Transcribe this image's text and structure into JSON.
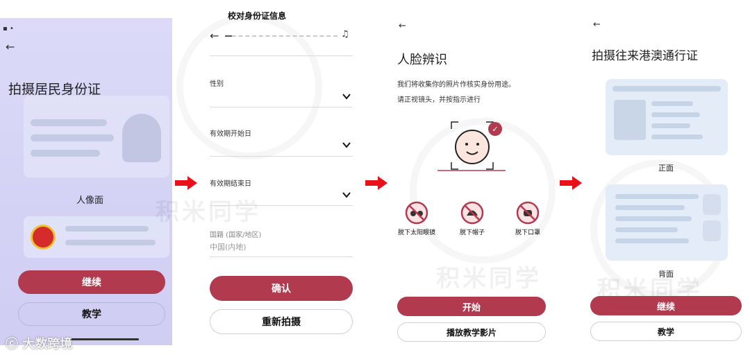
{
  "panel1": {
    "title": "拍摄居民身份证",
    "portrait_label": "人像面",
    "continue_button": "继续",
    "tutorial_button": "教学",
    "watermark_logo": "大数跨境"
  },
  "panel2": {
    "title": "校对身份证信息",
    "gender_label": "性别",
    "valid_start_label": "有效期开始日",
    "valid_end_label": "有效期结束日",
    "nationality_label": "国籍 (国家/地区)",
    "nationality_value": "中国(内地)",
    "confirm_button": "确认",
    "retake_button": "重新拍摄"
  },
  "panel3": {
    "title": "人脸辨识",
    "description_line1": "我们将收集你的照片作核实身份用途。",
    "description_line2": "请正视镜头，并按指示进行",
    "tip_glasses": "脱下太阳眼镜",
    "tip_hat": "脱下帽子",
    "tip_mask": "脱下口罩",
    "start_button": "开始",
    "play_tutorial_button": "播放教学影片"
  },
  "panel4": {
    "title": "拍摄往来港澳通行证",
    "front_label": "正面",
    "back_label": "背面",
    "continue_button": "继续",
    "tutorial_button": "教学"
  },
  "watermark_text": "积米同学",
  "colors": {
    "accent": "#b23a4f",
    "arrow": "#e8111a",
    "panel1_tint": "#d8d6f5"
  }
}
